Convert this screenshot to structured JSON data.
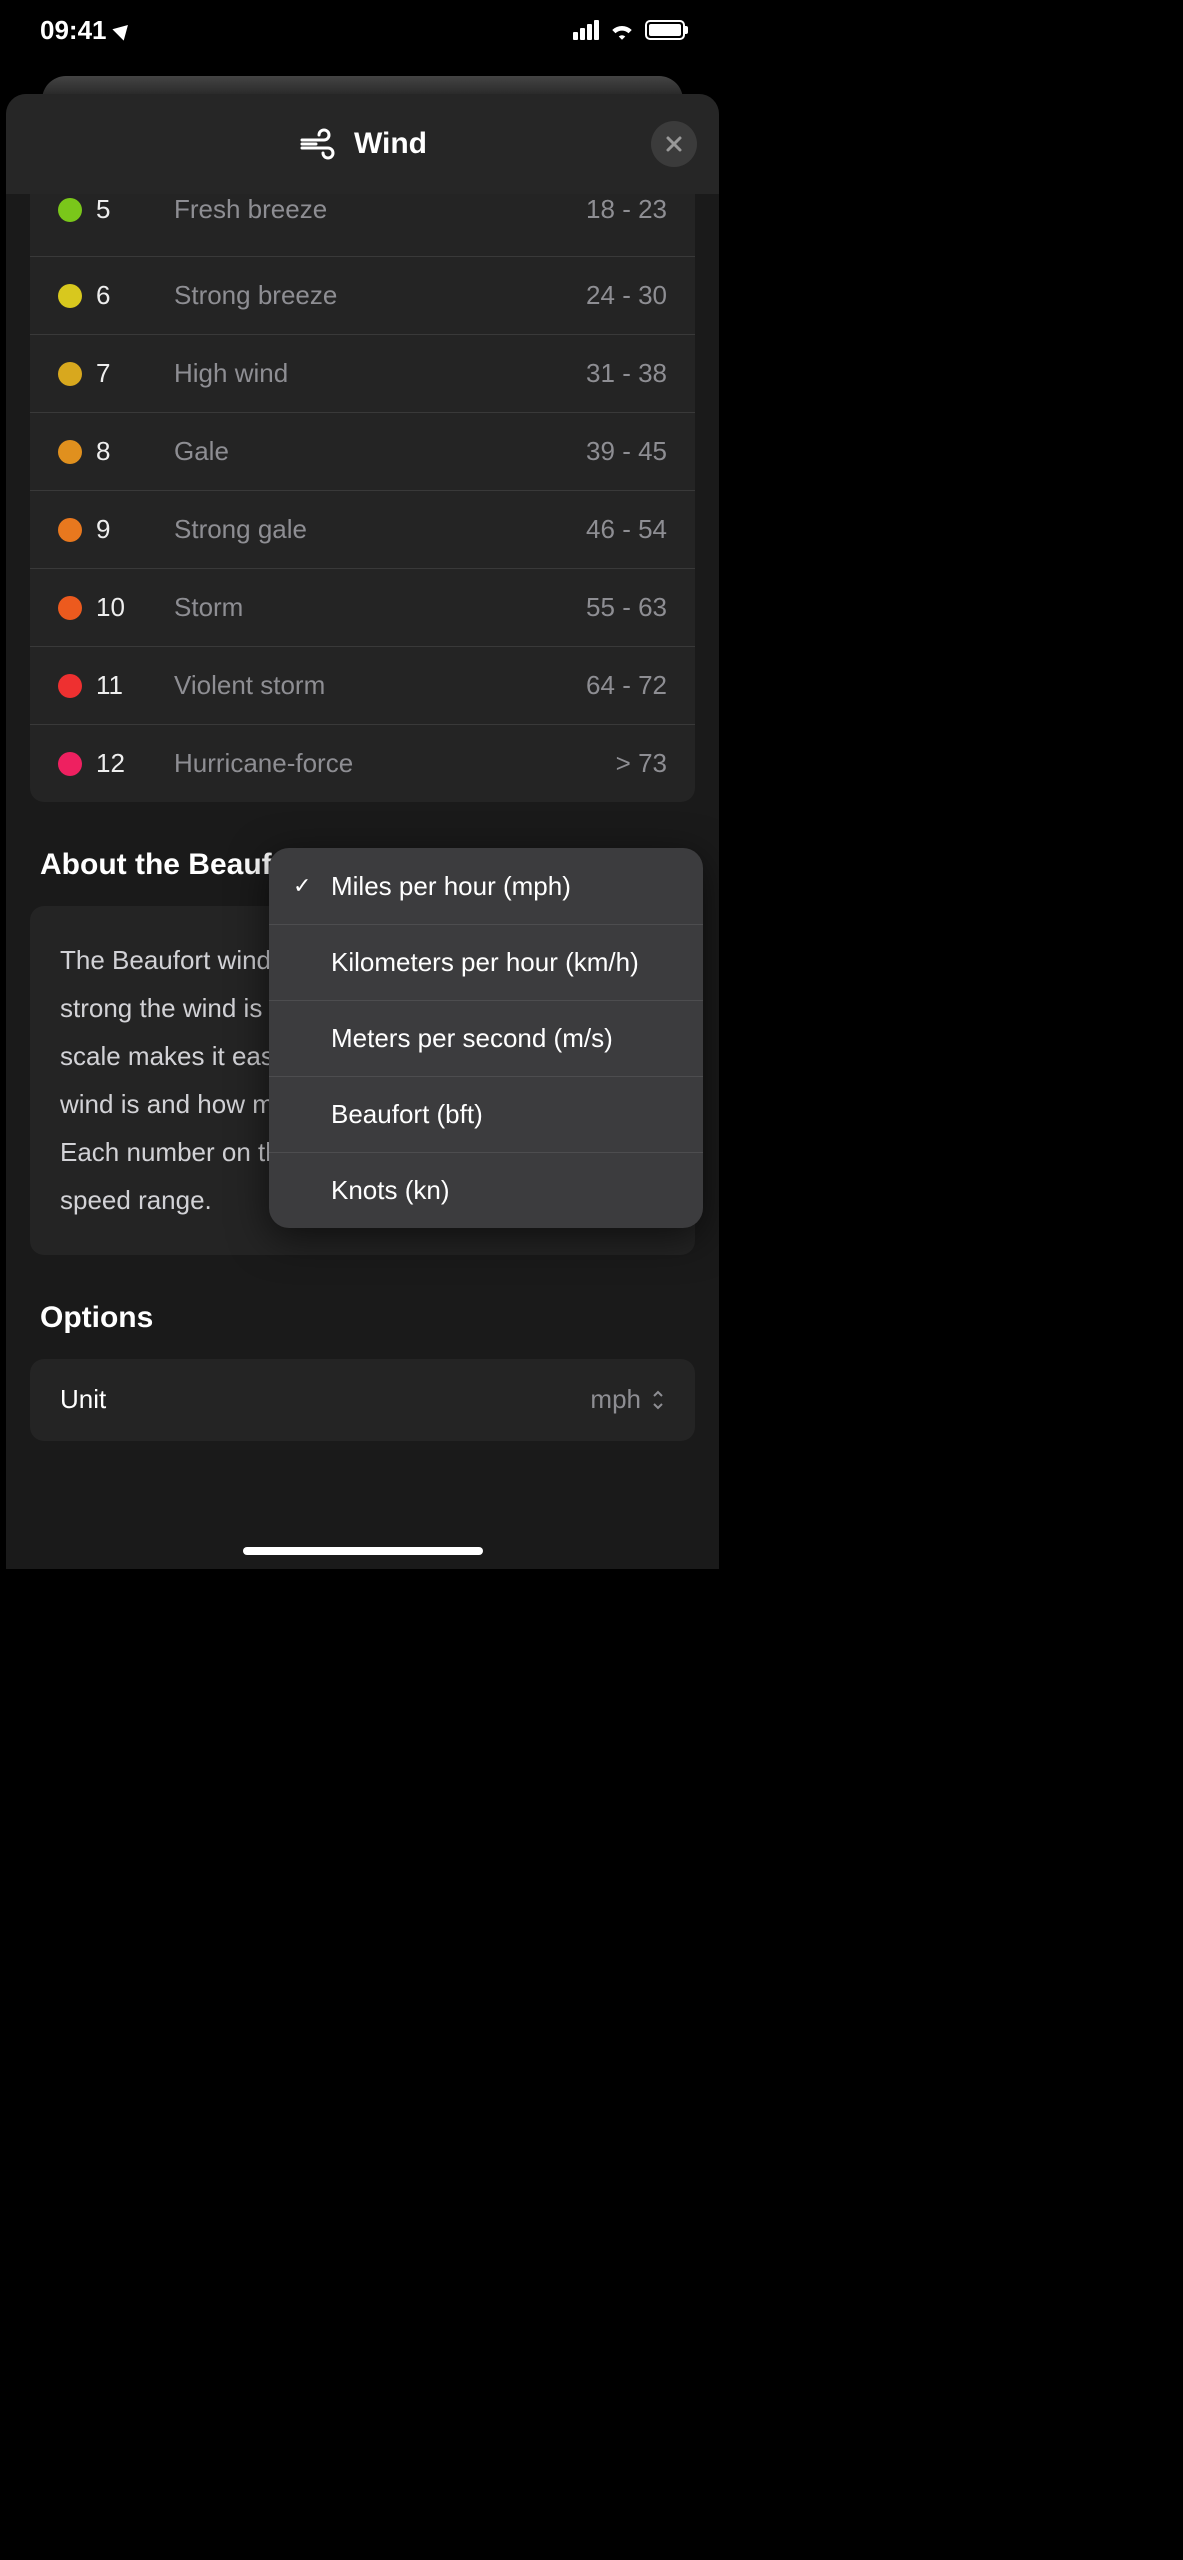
{
  "status": {
    "time": "09:41"
  },
  "header": {
    "title": "Wind"
  },
  "scale_rows": [
    {
      "num": "5",
      "name": "Fresh breeze",
      "range": "18 - 23",
      "color": "#7ac71a"
    },
    {
      "num": "6",
      "name": "Strong breeze",
      "range": "24 - 30",
      "color": "#d8c81e"
    },
    {
      "num": "7",
      "name": "High wind",
      "range": "31 - 38",
      "color": "#d8a81e"
    },
    {
      "num": "8",
      "name": "Gale",
      "range": "39 - 45",
      "color": "#e0901e"
    },
    {
      "num": "9",
      "name": "Strong gale",
      "range": "46 - 54",
      "color": "#e8781e"
    },
    {
      "num": "10",
      "name": "Storm",
      "range": "55 - 63",
      "color": "#ec5a1e"
    },
    {
      "num": "11",
      "name": "Violent storm",
      "range": "64 - 72",
      "color": "#ee3030"
    },
    {
      "num": "12",
      "name": "Hurricane-force",
      "range": "> 73",
      "color": "#ee2060"
    }
  ],
  "about": {
    "title": "About the Beaufort Scale",
    "body": "The Beaufort wind scale expresses how forceful or strong the wind is based on its speed. The Beaufort scale makes it easy to understand how strong the wind is and how much effect the wind can have. Each number on the scale corresponds to a wind speed range."
  },
  "options": {
    "title": "Options",
    "unit_label": "Unit",
    "unit_value": "mph"
  },
  "unit_menu": {
    "items": [
      {
        "label": "Miles per hour (mph)",
        "checked": true
      },
      {
        "label": "Kilometers per hour (km/h)",
        "checked": false
      },
      {
        "label": "Meters per second (m/s)",
        "checked": false
      },
      {
        "label": "Beaufort (bft)",
        "checked": false
      },
      {
        "label": "Knots (kn)",
        "checked": false
      }
    ]
  }
}
